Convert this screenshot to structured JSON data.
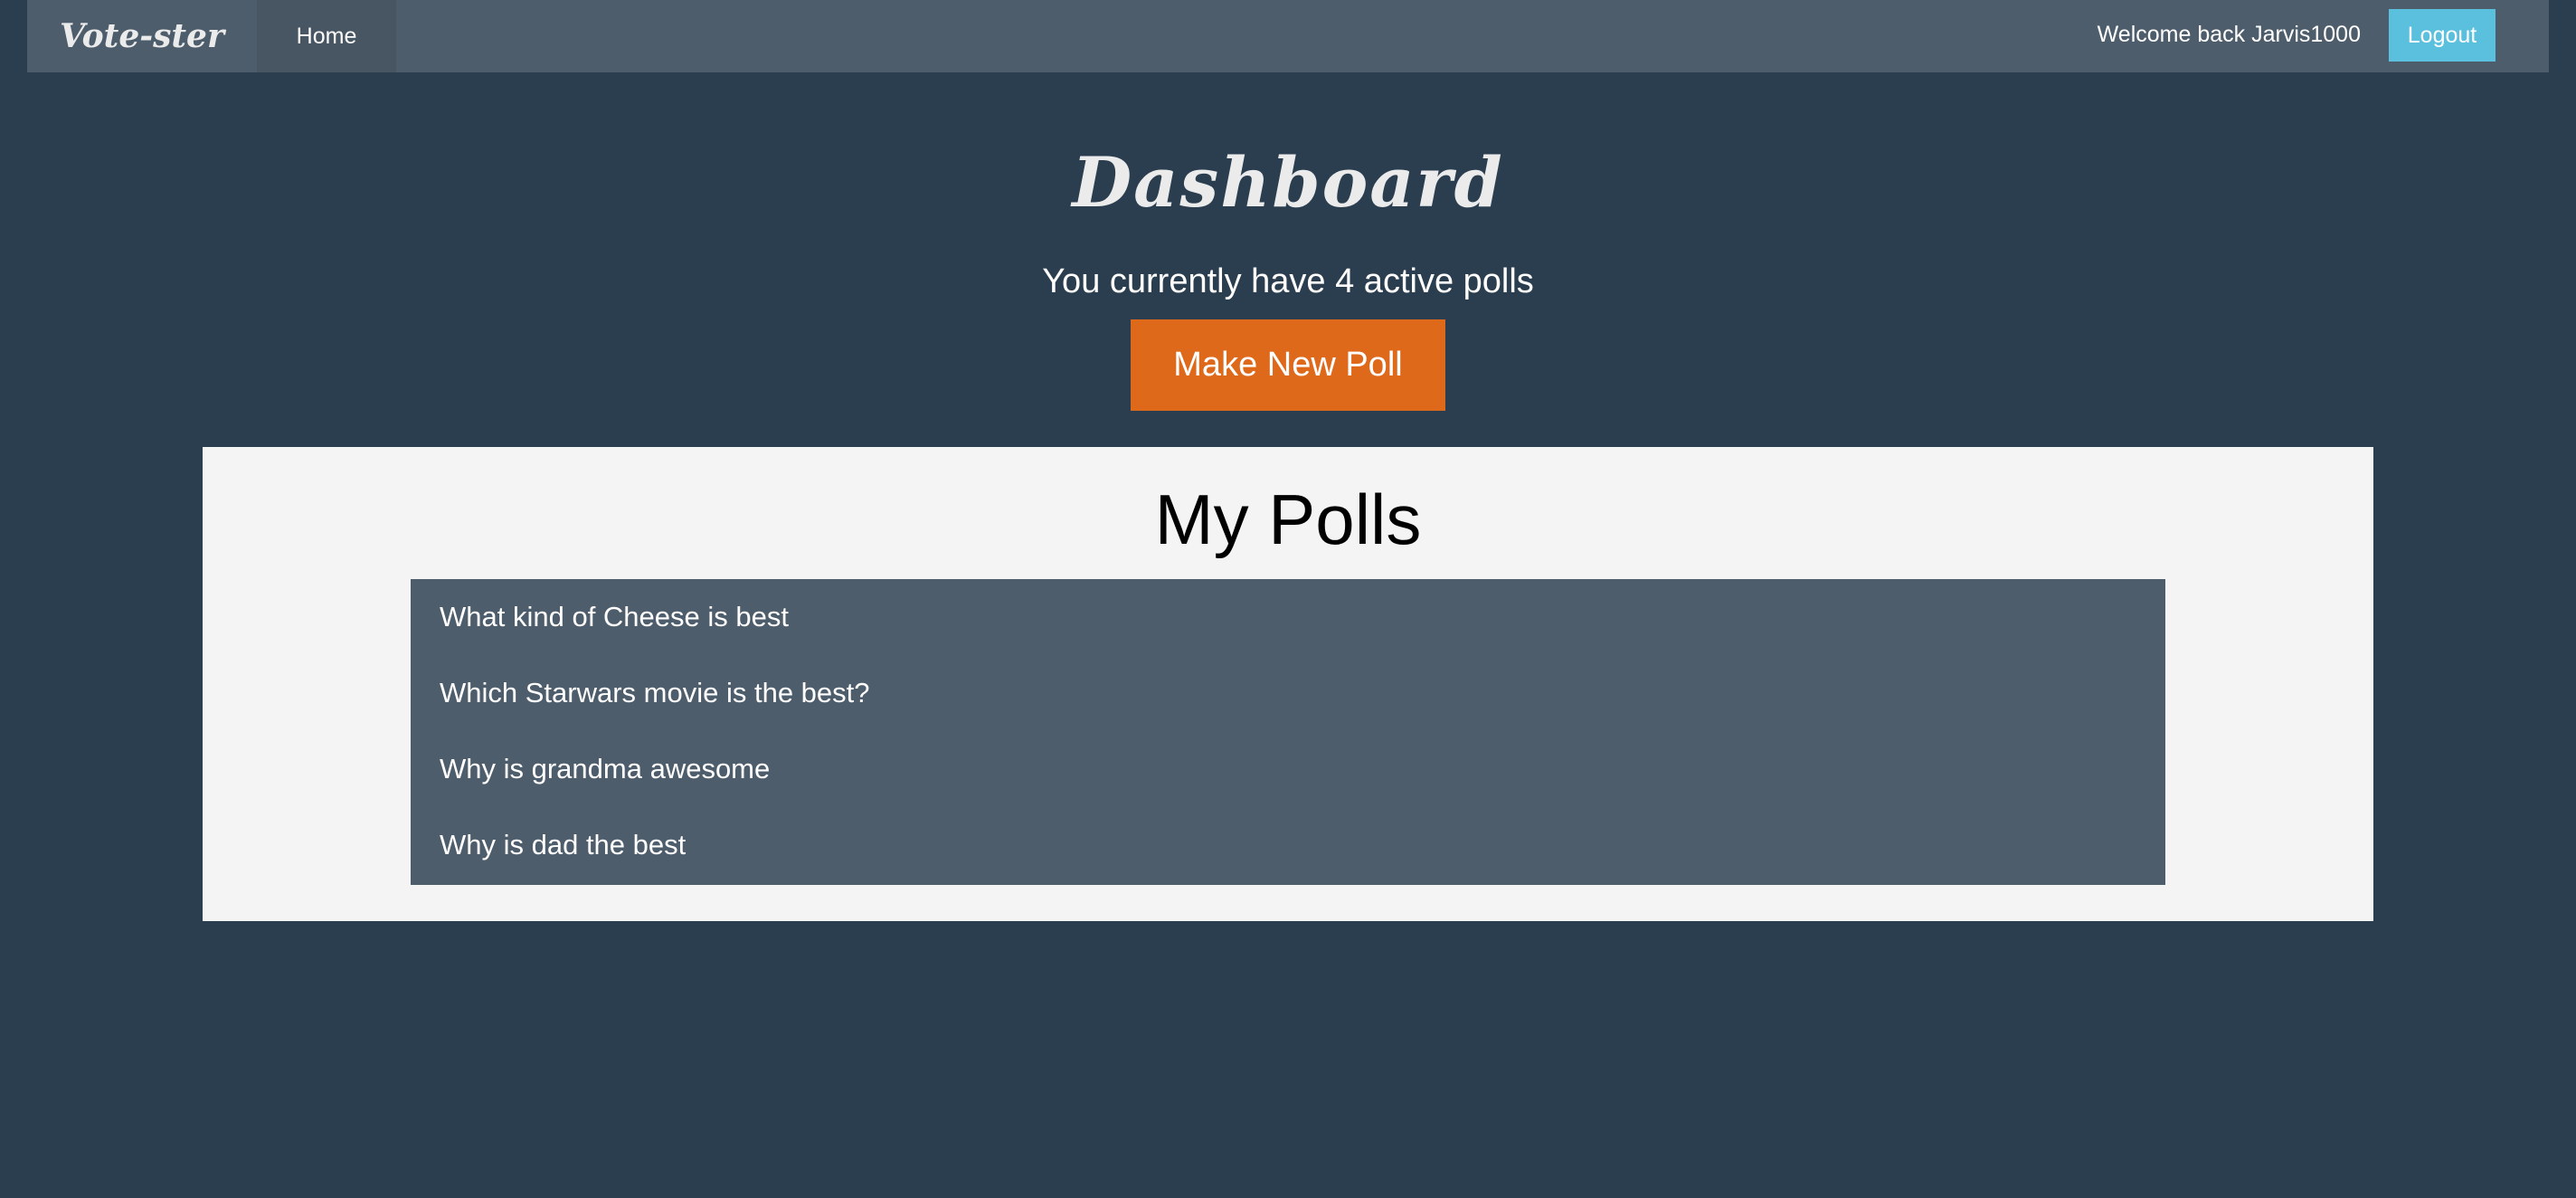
{
  "navbar": {
    "brand": "Vote-ster",
    "home_label": "Home",
    "welcome_text": "Welcome back Jarvis1000",
    "logout_label": "Logout"
  },
  "main": {
    "title": "Dashboard",
    "subtitle": "You currently have 4 active polls",
    "new_poll_label": "Make New Poll"
  },
  "polls": {
    "heading": "My Polls",
    "items": [
      {
        "label": "What kind of Cheese is best"
      },
      {
        "label": "Which Starwars movie is the best?"
      },
      {
        "label": "Why is grandma awesome"
      },
      {
        "label": "Why is dad the best"
      }
    ]
  },
  "colors": {
    "background": "#2b3e50",
    "navbar": "#4e5d6c",
    "accent_orange": "#df691a",
    "info_blue": "#5bc0de",
    "panel": "#f4f4f4"
  }
}
